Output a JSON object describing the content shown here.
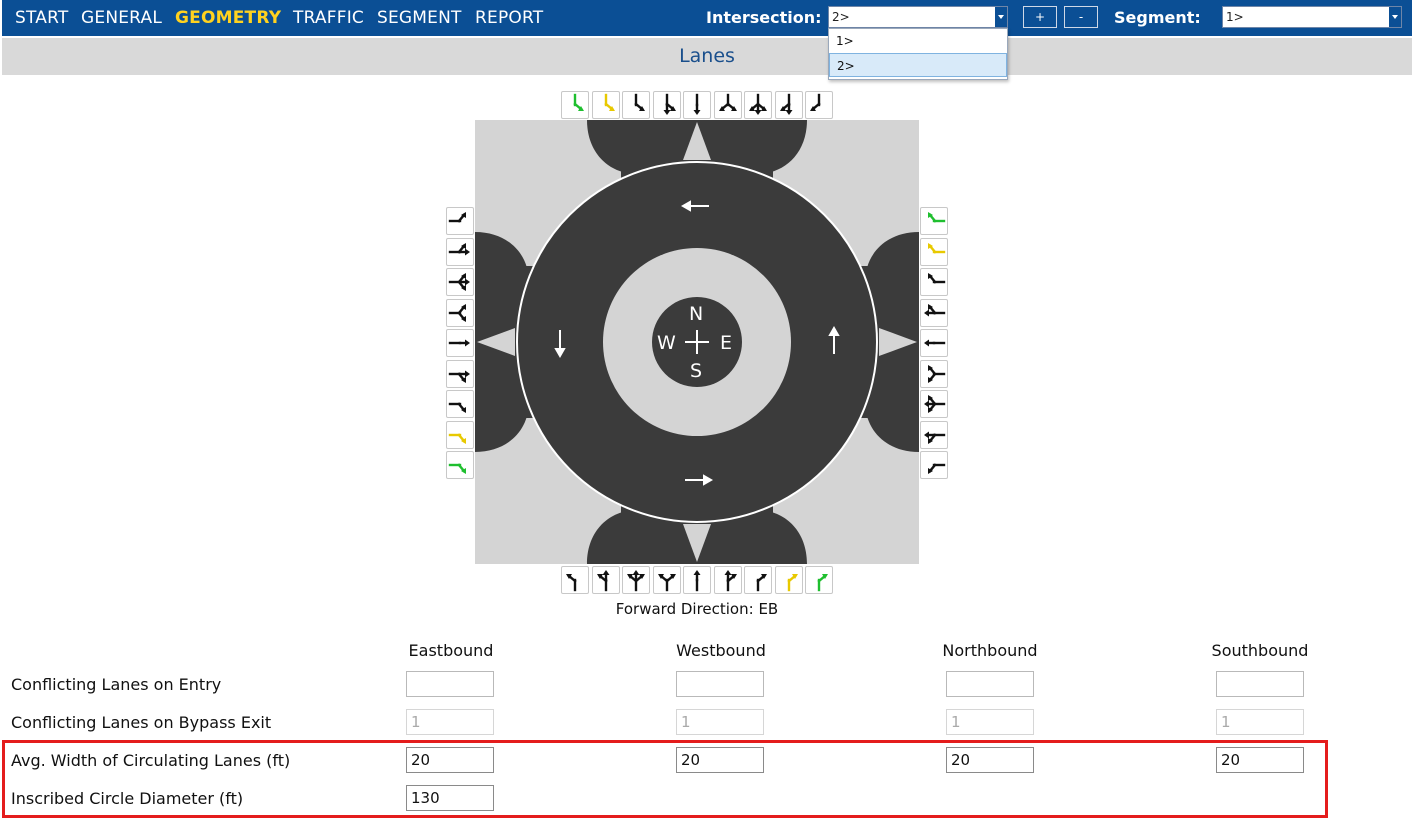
{
  "nav": {
    "items": [
      "START",
      "GENERAL",
      "GEOMETRY",
      "TRAFFIC",
      "SEGMENT",
      "REPORT"
    ],
    "active": "GEOMETRY"
  },
  "intersection": {
    "label": "Intersection:",
    "value": "2>",
    "options": [
      "1>",
      "2>"
    ],
    "selected": "2>",
    "add_label": "+",
    "remove_label": "-"
  },
  "segment": {
    "label": "Segment:",
    "value": "1>"
  },
  "section_title": "Lanes",
  "compass": {
    "n": "N",
    "s": "S",
    "e": "E",
    "w": "W"
  },
  "lane_config": {
    "north_icons": [
      "left-green",
      "left-yellow",
      "left",
      "left-through",
      "through",
      "left-right",
      "all",
      "through-right",
      "right"
    ],
    "south_icons": [
      "left",
      "left-through",
      "all",
      "left-right",
      "through",
      "through-right",
      "right",
      "right-yellow",
      "right-green"
    ],
    "west_icons": [
      "left",
      "left-through",
      "all",
      "left-right",
      "through",
      "through-right",
      "right",
      "right-yellow",
      "right-green"
    ],
    "east_icons": [
      "right-green",
      "right-yellow",
      "right",
      "through-right",
      "through",
      "left-right",
      "all",
      "left-through",
      "left"
    ],
    "highlight_colors": {
      "green": "#1fbf2f",
      "yellow": "#e8c900"
    }
  },
  "forward_direction": "Forward Direction: EB",
  "columns": [
    "Eastbound",
    "Westbound",
    "Northbound",
    "Southbound"
  ],
  "rows": [
    {
      "label": "Conflicting Lanes on Entry",
      "values": [
        "",
        "",
        "",
        ""
      ]
    },
    {
      "label": "Conflicting Lanes on Bypass Exit",
      "values": [
        "1",
        "1",
        "1",
        "1"
      ]
    },
    {
      "label": "Avg. Width of Circulating Lanes (ft)",
      "values": [
        "20",
        "20",
        "20",
        "20"
      ]
    },
    {
      "label": "Inscribed Circle Diameter (ft)",
      "values": [
        "130"
      ]
    }
  ],
  "colors": {
    "header_bg": "#0b4f95",
    "active_nav": "#ffd21f",
    "highlight_box": "#e41c1c",
    "asphalt": "#3b3b3b"
  }
}
